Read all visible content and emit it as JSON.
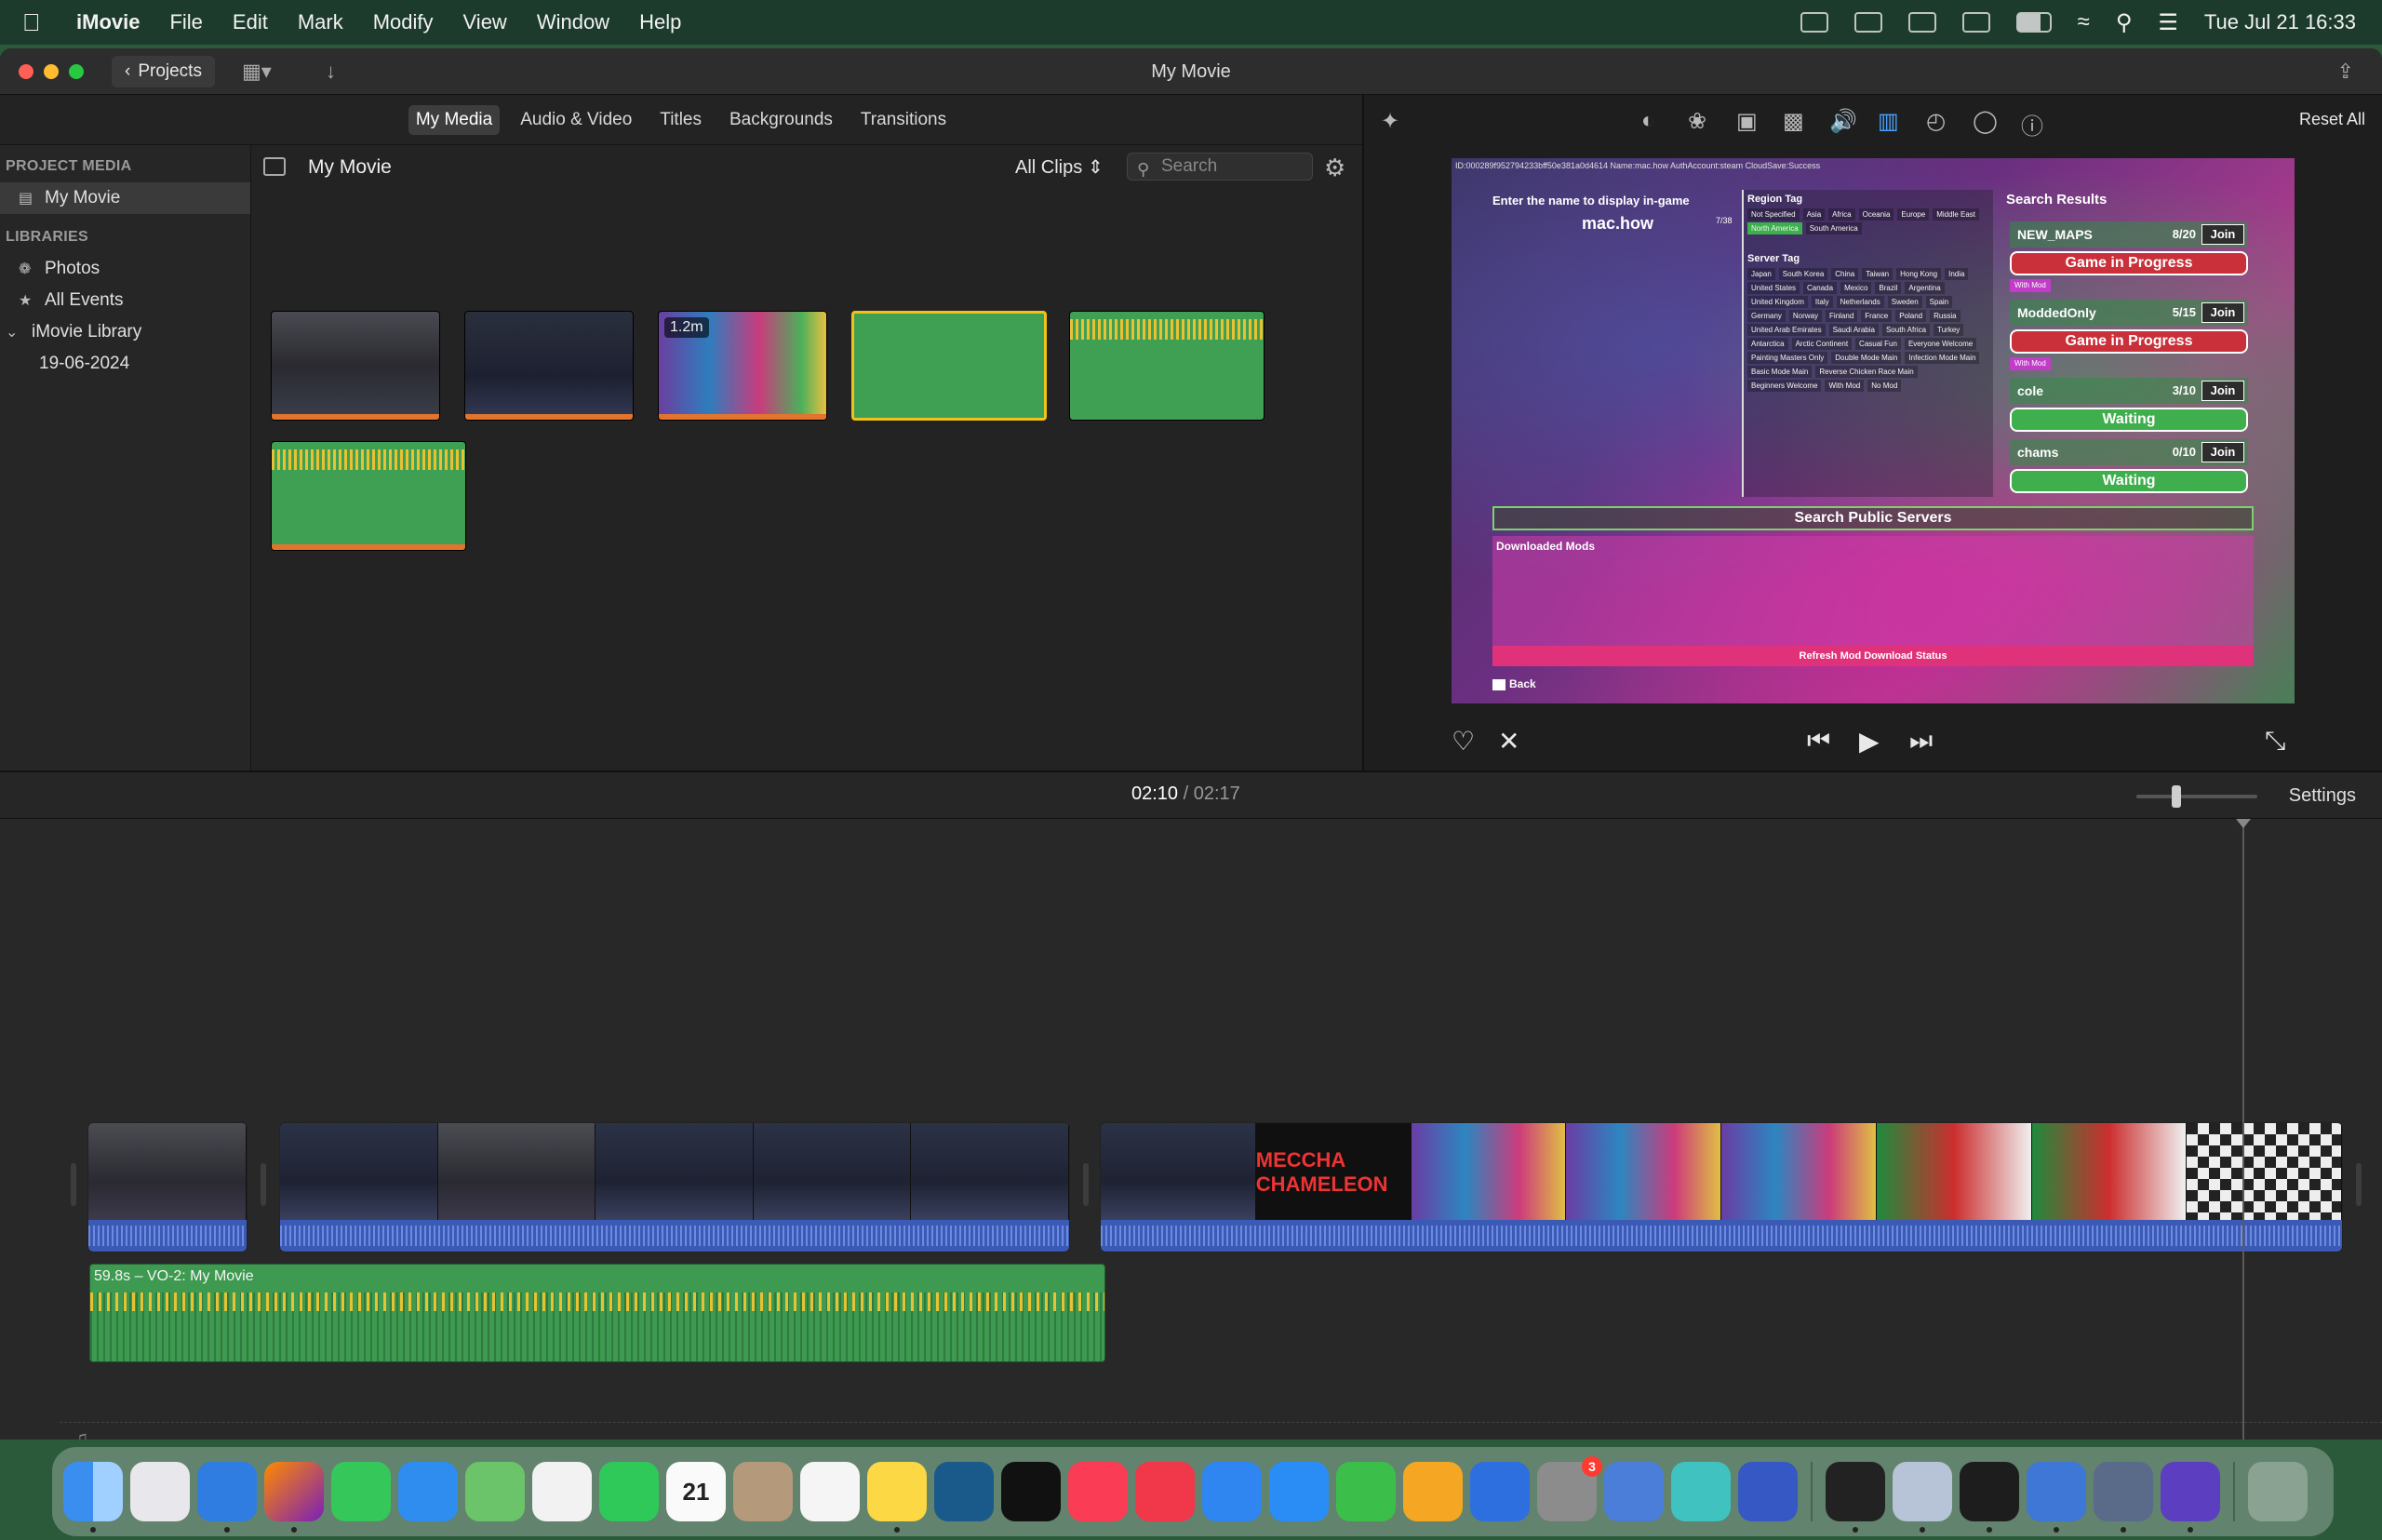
{
  "menubar": {
    "app": "iMovie",
    "items": [
      "File",
      "Edit",
      "Mark",
      "Modify",
      "View",
      "Window",
      "Help"
    ],
    "clock": "Tue Jul 21  16:33"
  },
  "window": {
    "title": "My Movie",
    "projects_label": "Projects"
  },
  "browser": {
    "tabs": [
      "My Media",
      "Audio & Video",
      "Titles",
      "Backgrounds",
      "Transitions"
    ],
    "active_tab": "My Media",
    "media_title": "My Movie",
    "clips_filter": "All Clips",
    "search_placeholder": "Search",
    "thumb_badge": "1.2m"
  },
  "sidebar": {
    "project_media_header": "PROJECT MEDIA",
    "project_item": "My Movie",
    "libraries_header": "LIBRARIES",
    "photos": "Photos",
    "all_events": "All Events",
    "library": "iMovie Library",
    "event_date": "19-06-2024"
  },
  "viewer": {
    "reset_all": "Reset All",
    "screen": {
      "top_line": "ID:000289f952794233bff50e381a0d4614    Name:mac.how    AuthAccount:steam    CloudSave:Success",
      "name_prompt": "Enter the name to display in-game",
      "player_name": "mac.how",
      "name_count": "7/38",
      "region_tag": "Region Tag",
      "region_tags": [
        "Not Specified",
        "Asia",
        "Africa",
        "Oceania",
        "Europe",
        "Middle East",
        "North America",
        "South America"
      ],
      "selected_region": "North America",
      "server_tag": "Server Tag",
      "server_tags": [
        "Japan",
        "South Korea",
        "China",
        "Taiwan",
        "Hong Kong",
        "India",
        "United States",
        "Canada",
        "Mexico",
        "Brazil",
        "Argentina",
        "United Kingdom",
        "Italy",
        "Netherlands",
        "Sweden",
        "Spain",
        "Germany",
        "Norway",
        "Finland",
        "France",
        "Poland",
        "Russia",
        "United Arab Emirates",
        "Saudi Arabia",
        "South Africa",
        "Turkey",
        "Antarctica",
        "Arctic Continent",
        "Casual Fun",
        "Everyone Welcome",
        "Painting Masters Only",
        "Double Mode Main",
        "Infection Mode Main",
        "Basic Mode Main",
        "Reverse Chicken Race Main",
        "Beginners Welcome",
        "With Mod",
        "No Mod"
      ],
      "results_title": "Search Results",
      "mod_tag": "With Mod",
      "join_label": "Join",
      "servers": [
        {
          "name": "NEW_MAPS",
          "count": "8/20",
          "status": "Game in Progress",
          "status_type": "red",
          "with_mod": true
        },
        {
          "name": "ModdedOnly",
          "count": "5/15",
          "status": "Game in Progress",
          "status_type": "red",
          "with_mod": true
        },
        {
          "name": "cole",
          "count": "3/10",
          "status": "Waiting",
          "status_type": "green",
          "with_mod": false
        },
        {
          "name": "chams",
          "count": "0/10",
          "status": "Waiting",
          "status_type": "green",
          "with_mod": false
        }
      ],
      "search_public": "Search Public Servers",
      "downloaded_mods": "Downloaded Mods",
      "refresh": "Refresh Mod Download Status",
      "back": "Back"
    }
  },
  "timeline": {
    "current_time": "02:10",
    "separator": "/",
    "total_time": "02:17",
    "settings": "Settings",
    "vo_label": "59.8s – VO-2: My Movie",
    "title_card": "MECCHA CHAMELEON"
  },
  "dock": {
    "settings_badge": "3",
    "calendar_day": "21"
  }
}
